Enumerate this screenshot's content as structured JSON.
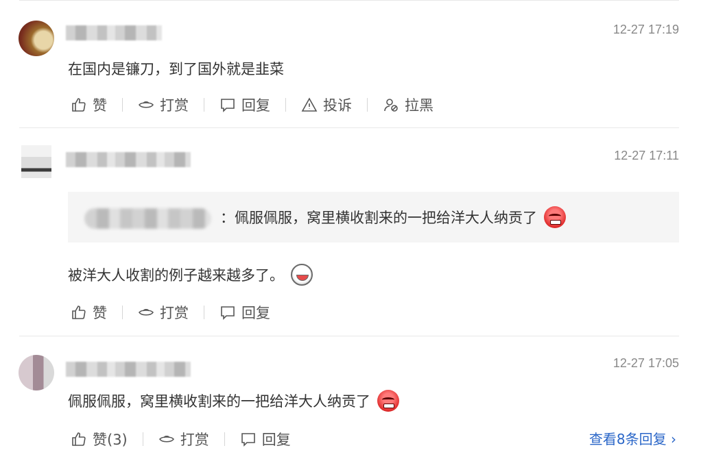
{
  "comments": [
    {
      "time": "12-27 17:19",
      "text": "在国内是镰刀，到了国外就是韭菜",
      "actions": {
        "like": "赞",
        "tip": "打赏",
        "reply": "回复",
        "report": "投诉",
        "block": "拉黑"
      }
    },
    {
      "time": "12-27 17:11",
      "quote": {
        "separator": "：",
        "text": "佩服佩服，窝里横收割来的一把给洋大人纳贡了"
      },
      "text": "被洋大人收割的例子越来越多了。",
      "actions": {
        "like": "赞",
        "tip": "打赏",
        "reply": "回复"
      }
    },
    {
      "time": "12-27 17:05",
      "text": "佩服佩服，窝里横收割来的一把给洋大人纳贡了",
      "actions": {
        "like": "赞(3)",
        "tip": "打赏",
        "reply": "回复"
      },
      "more_replies": "查看8条回复 ›"
    }
  ],
  "icons": [
    "thumbs-up-icon",
    "tip-icon",
    "comment-icon",
    "warning-icon",
    "block-user-icon",
    "angry-emoji-icon",
    "laughing-emoji-icon"
  ],
  "colors": {
    "link": "#2a66c8",
    "time": "#888888",
    "text": "#333333"
  }
}
